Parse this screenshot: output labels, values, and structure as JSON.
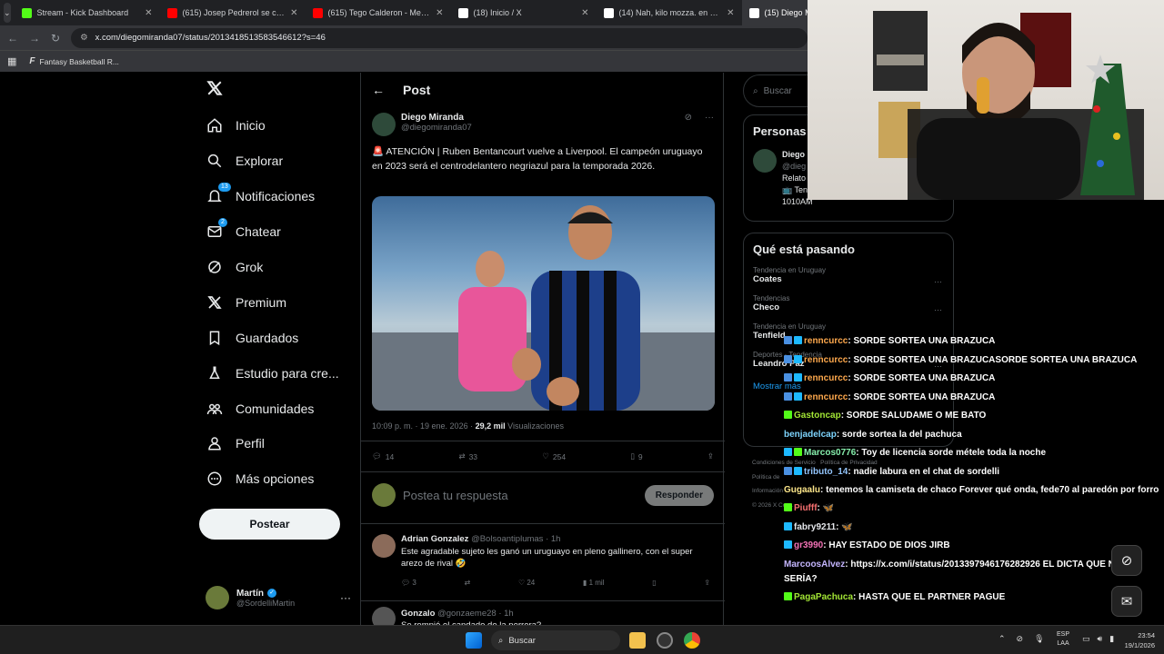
{
  "browser": {
    "tabs": [
      {
        "label": "Stream - Kick Dashboard",
        "icon": "kick-icon",
        "color": "#53fc18",
        "active": false
      },
      {
        "label": "(615) Josep Pedrerol se cabrea ...",
        "icon": "youtube-icon",
        "color": "#ff0000",
        "active": false
      },
      {
        "label": "(615) Tego Calderon - Metele S...",
        "icon": "youtube-icon",
        "color": "#ff0000",
        "active": false
      },
      {
        "label": "(18) Inicio / X",
        "icon": "x-icon",
        "color": "#ffffff",
        "active": false
      },
      {
        "label": "(14) Nah, kilo mozza. en X: \"Pa...",
        "icon": "x-icon",
        "color": "#ffffff",
        "active": false
      },
      {
        "label": "(15) Diego M",
        "icon": "x-icon",
        "color": "#ffffff",
        "active": true
      }
    ],
    "url": "x.com/diegomiranda07/status/2013418513583546612?s=46",
    "bookmark": "Fantasy Basketball R..."
  },
  "nav": {
    "items": [
      {
        "label": "Inicio",
        "icon": "home-icon",
        "badge": ""
      },
      {
        "label": "Explorar",
        "icon": "search-icon",
        "badge": ""
      },
      {
        "label": "Notificaciones",
        "icon": "bell-icon",
        "badge": "13"
      },
      {
        "label": "Chatear",
        "icon": "mail-icon",
        "badge": "2"
      },
      {
        "label": "Grok",
        "icon": "grok-icon",
        "badge": ""
      },
      {
        "label": "Premium",
        "icon": "x-premium-icon",
        "badge": ""
      },
      {
        "label": "Guardados",
        "icon": "bookmark-icon",
        "badge": ""
      },
      {
        "label": "Estudio para cre...",
        "icon": "flask-icon",
        "badge": ""
      },
      {
        "label": "Comunidades",
        "icon": "people-icon",
        "badge": ""
      },
      {
        "label": "Perfil",
        "icon": "person-icon",
        "badge": ""
      },
      {
        "label": "Más opciones",
        "icon": "more-circle-icon",
        "badge": ""
      }
    ],
    "post_button": "Postear",
    "user": {
      "name": "Martín",
      "handle": "@SordelliMartin"
    }
  },
  "post": {
    "header": "Post",
    "author": "Diego Miranda",
    "handle": "@diegomiranda07",
    "text": "🚨 ATENCIÓN | Ruben Bentancourt vuelve a Liverpool. El campeón uruguayo en 2023 será el centrodelantero negriazul para la temporada 2026.",
    "time": "10:09 p. m. · 19 ene. 2026 ·",
    "views": "29,2 mil",
    "views_label": "Visualizaciones",
    "replies": "14",
    "reposts": "33",
    "likes": "254",
    "bookmarks": "9",
    "reply_placeholder": "Postea tu respuesta",
    "reply_button": "Responder"
  },
  "replies": [
    {
      "name": "Adrian Gonzalez",
      "handle": "@Bolsoantiplumas · 1h",
      "text": "Este agradable sujeto les ganó un uruguayo en pleno gallinero, con el super arezo de rival 🤣",
      "replies": "3",
      "reposts": "",
      "likes": "24",
      "views": "1 mil"
    },
    {
      "name": "Gonzalo",
      "handle": "@gonzaeme28 · 1h",
      "text": "Se rompió el candado de la perrera?"
    }
  ],
  "right": {
    "search_placeholder": "Buscar",
    "persons_title": "Personas",
    "person_name": "Diego",
    "person_handle": "@dieg",
    "person_bio1": "Relato",
    "person_bio2": "📺 Ten",
    "person_bio3": "1010AM",
    "trending_title": "Qué está pasando",
    "trends": [
      {
        "context": "Tendencia en Uruguay",
        "topic": "Coates"
      },
      {
        "context": "Tendencias",
        "topic": "Checo"
      },
      {
        "context": "Tendencia en Uruguay",
        "topic": "Tenfield"
      },
      {
        "context": "Deportes · Tendencia",
        "topic": "Leandro Paz"
      }
    ],
    "show_more": "Mostrar más",
    "footer1": "Condiciones de Servicio",
    "footer2": "Política de Privacidad",
    "footer3": "Política de",
    "footer4": "Información",
    "footer5": "© 2026 X Corp."
  },
  "chat": [
    {
      "user": "renncurcc",
      "color": "#ffa94d",
      "msg": ": SORDE SORTEA UNA BRAZUCA",
      "badges": [
        "#4a90e2",
        "#1db9ff"
      ]
    },
    {
      "user": "renncurcc",
      "color": "#ffa94d",
      "msg": ": SORDE SORTEA UNA BRAZUCASORDE SORTEA UNA BRAZUCA",
      "badges": [
        "#4a90e2",
        "#1db9ff"
      ]
    },
    {
      "user": "renncurcc",
      "color": "#ffa94d",
      "msg": ": SORDE SORTEA UNA BRAZUCA",
      "badges": [
        "#4a90e2",
        "#1db9ff"
      ]
    },
    {
      "user": "renncurcc",
      "color": "#ffa94d",
      "msg": ": SORDE SORTEA UNA BRAZUCA",
      "badges": [
        "#4a90e2",
        "#1db9ff"
      ]
    },
    {
      "user": "Gastoncap",
      "color": "#a3e635",
      "msg": ": SORDE SALUDAME O ME BATO",
      "badges": [
        "#53fc18"
      ]
    },
    {
      "user": "benjadelcap",
      "color": "#7dd3fc",
      "msg": ": sorde sortea la del pachuca",
      "badges": []
    },
    {
      "user": "Marcos0776",
      "color": "#86efac",
      "msg": ": Toy de licencia sorde métele toda la noche",
      "badges": [
        "#1db9ff",
        "#53fc18"
      ]
    },
    {
      "user": "tributo_14",
      "color": "#93c5fd",
      "msg": ": nadie labura en el chat de sordelli",
      "badges": [
        "#4a90e2",
        "#1db9ff"
      ]
    },
    {
      "user": "Gugaalu",
      "color": "#fde68a",
      "msg": ": tenemos la camiseta de chaco Forever qué onda, fede70 al paredón por forro",
      "badges": [],
      "wrap": true
    },
    {
      "user": "Piufff",
      "color": "#f87171",
      "msg": ": 🦋",
      "badges": [
        "#53fc18"
      ]
    },
    {
      "user": "fabry9211",
      "color": "#e5e7eb",
      "msg": ": 🦋",
      "badges": [
        "#1db9ff"
      ]
    },
    {
      "user": "gr3990",
      "color": "#f472b6",
      "msg": ": HAY ESTADO DE DIOS JIRB",
      "badges": [
        "#1db9ff"
      ]
    },
    {
      "user": "MarcoosAlvez",
      "color": "#c4b5fd",
      "msg": ": https://x.com/i/status/2013397946176282926 EL DICTA QUE NIVEL SERÍA?",
      "badges": [],
      "wrap": true
    },
    {
      "user": "PagaPachuca",
      "color": "#a3e635",
      "msg": ": HASTA QUE EL PARTNER PAGUE",
      "badges": [
        "#53fc18"
      ]
    }
  ],
  "taskbar": {
    "search": "Buscar",
    "lang1": "ESP",
    "lang2": "LAA",
    "time": "23:54",
    "date": "19/1/2026"
  }
}
